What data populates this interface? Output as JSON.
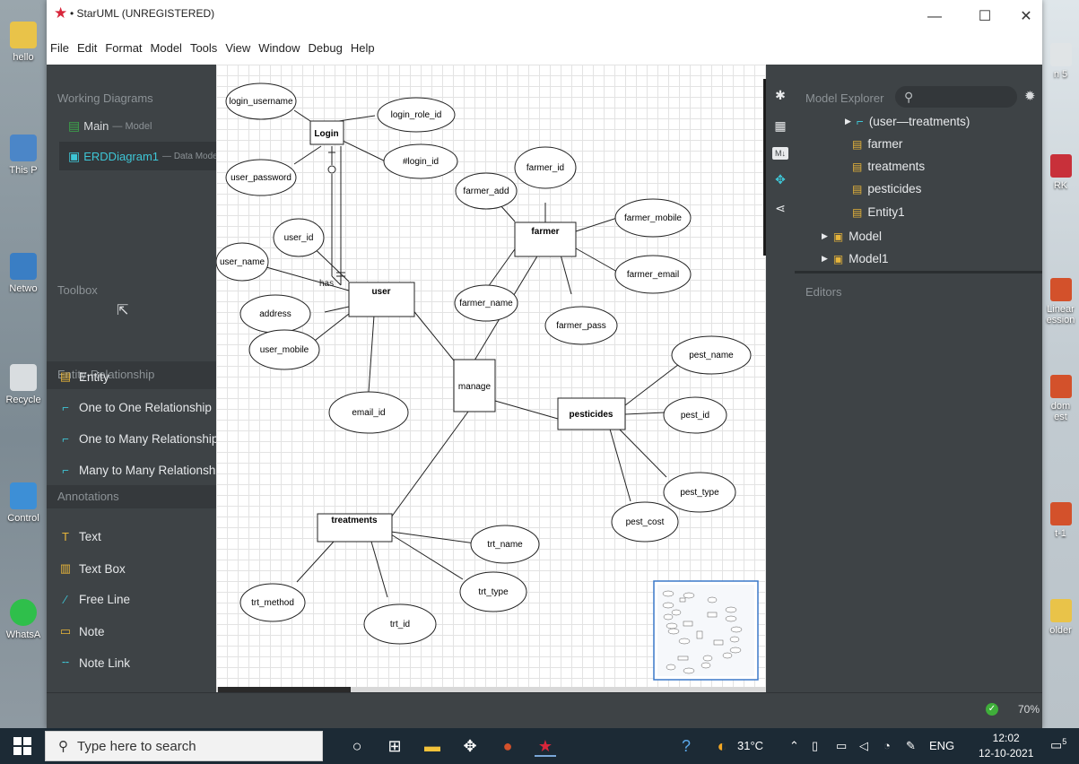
{
  "desktop": {
    "left_icons": [
      {
        "label": "hello"
      },
      {
        "label": "This P"
      },
      {
        "label": "Netwo"
      },
      {
        "label": "Recycle"
      },
      {
        "label": "Control"
      },
      {
        "label": "WhatsA"
      }
    ],
    "right_icons": [
      {
        "label": "n 5"
      },
      {
        "label": "RK"
      },
      {
        "label": "Linear\nession"
      },
      {
        "label": "dom\nest"
      },
      {
        "label": "t-1"
      },
      {
        "label": "older"
      }
    ]
  },
  "window": {
    "title": "• StarUML (UNREGISTERED)",
    "controls": {
      "minimize": "—",
      "maximize": "☐",
      "close": "✕"
    },
    "menu": [
      "File",
      "Edit",
      "Format",
      "Model",
      "Tools",
      "View",
      "Window",
      "Debug",
      "Help"
    ]
  },
  "working_diagrams": {
    "heading": "Working Diagrams",
    "items": [
      {
        "name": "Main",
        "suffix": "— Model",
        "color": "#d7dadc"
      },
      {
        "name": "ERDDiagram1",
        "suffix": "— Data Model1",
        "color": "#3ec6d6"
      }
    ]
  },
  "toolbox": {
    "heading": "Toolbox",
    "pointer_icon": "cursor-arrow-icon",
    "groups": [
      {
        "label": "Entity-Relationship",
        "arrow": "▲"
      },
      {
        "label": "Annotations",
        "arrow": "▲"
      }
    ],
    "er_items": [
      {
        "label": "Entity",
        "icon": "entity-icon"
      },
      {
        "label": "One to One Relationship",
        "icon": "one-to-one-icon"
      },
      {
        "label": "One to Many Relationship",
        "icon": "one-to-many-icon"
      },
      {
        "label": "Many to Many Relationship",
        "icon": "many-to-many-icon"
      }
    ],
    "annotation_items": [
      {
        "label": "Text",
        "icon": "text-icon"
      },
      {
        "label": "Text Box",
        "icon": "text-box-icon"
      },
      {
        "label": "Free Line",
        "icon": "free-line-icon"
      },
      {
        "label": "Note",
        "icon": "note-icon"
      },
      {
        "label": "Note Link",
        "icon": "note-link-icon"
      }
    ]
  },
  "diagram": {
    "entities": [
      {
        "name": "Login"
      },
      {
        "name": "farmer"
      },
      {
        "name": "user"
      },
      {
        "name": "pesticides"
      },
      {
        "name": "treatments"
      }
    ],
    "relationship": {
      "name": "manage"
    },
    "attributes": [
      "login_username",
      "login_role_id",
      "user_password",
      "#login_id",
      "farmer_id",
      "farmer_add",
      "farmer_mobile",
      "farmer_email",
      "farmer_name",
      "farmer_pass",
      "user_id",
      "user_name",
      "address",
      "user_mobile",
      "email_id",
      "pest_name",
      "pest_id",
      "pest_type",
      "pest_cost",
      "trt_name",
      "trt_type",
      "trt_method",
      "trt_id"
    ],
    "edge_label": "has"
  },
  "model_explorer": {
    "heading": "Model Explorer",
    "search_icon": "search-icon",
    "settings_icon": "gear-icon",
    "tree": [
      {
        "label": "(user—treatments)",
        "icon": "relationship-icon",
        "expandable": true
      },
      {
        "label": "farmer",
        "icon": "entity-icon",
        "expandable": false
      },
      {
        "label": "treatments",
        "icon": "entity-icon",
        "expandable": false
      },
      {
        "label": "pesticides",
        "icon": "entity-icon",
        "expandable": false
      },
      {
        "label": "Entity1",
        "icon": "entity-icon",
        "expandable": false
      },
      {
        "label": "Model",
        "icon": "package-icon",
        "expandable": true
      },
      {
        "label": "Model1",
        "icon": "package-icon",
        "expandable": true
      }
    ]
  },
  "editors": {
    "heading": "Editors"
  },
  "right_toolbar": [
    "extensions-icon",
    "grid-icon",
    "markdown-icon",
    "navigate-icon",
    "share-icon"
  ],
  "status": {
    "zoom": "70%"
  },
  "taskbar": {
    "search_placeholder": "Type here to search",
    "weather": "31°C",
    "language": "ENG",
    "time": "12:02",
    "date": "12-10-2021",
    "notification_count": "5"
  }
}
